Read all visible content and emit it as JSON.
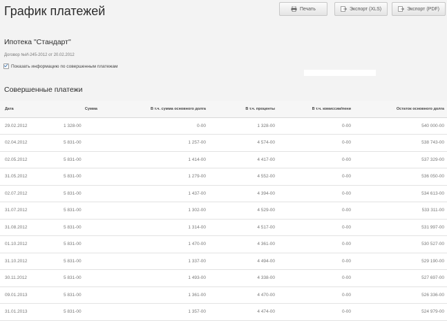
{
  "page": {
    "title": "График платежей",
    "subtitle": "Ипотека \"Стандарт\"",
    "contract": "Договор №И-245-2012 от 20.02.2012",
    "show_paid_label": "Показать информацию по совершенным платежам",
    "show_paid_checked": true,
    "section_title": "Совершенные платежи"
  },
  "toolbar": {
    "print_label": "Печать",
    "export_xls_label": "Экспорт (XLS)",
    "export_pdf_label": "Экспорт (PDF)"
  },
  "table": {
    "headers": [
      "Дата",
      "Сумма",
      "В т.ч. сумма основного долга",
      "В т.ч. проценты",
      "В т.ч. комиссии/пени",
      "Остаток основного долга"
    ],
    "rows": [
      [
        "29.02.2012",
        "1 328-00",
        "0-00",
        "1 328-00",
        "0-00",
        "540 000-00"
      ],
      [
        "02.04.2012",
        "5 831-00",
        "1 257-00",
        "4 574-00",
        "0-00",
        "538 743-00"
      ],
      [
        "02.05.2012",
        "5 831-00",
        "1 414-00",
        "4 417-00",
        "0-00",
        "537 329-00"
      ],
      [
        "31.05.2012",
        "5 831-00",
        "1 279-00",
        "4 552-00",
        "0-00",
        "536 050-00"
      ],
      [
        "02.07.2012",
        "5 831-00",
        "1 437-00",
        "4 394-00",
        "0-00",
        "534 613-00"
      ],
      [
        "31.07.2012",
        "5 831-00",
        "1 302-00",
        "4 529-00",
        "0-00",
        "533 311-00"
      ],
      [
        "31.08.2012",
        "5 831-00",
        "1 314-00",
        "4 517-00",
        "0-00",
        "531 997-00"
      ],
      [
        "01.10.2012",
        "5 831-00",
        "1 470-00",
        "4 361-00",
        "0-00",
        "530 527-00"
      ],
      [
        "31.10.2012",
        "5 831-00",
        "1 337-00",
        "4 494-00",
        "0-00",
        "529 190-00"
      ],
      [
        "30.11.2012",
        "5 831-00",
        "1 493-00",
        "4 338-00",
        "0-00",
        "527 697-00"
      ],
      [
        "09.01.2013",
        "5 831-00",
        "1 361-00",
        "4 470-00",
        "0-00",
        "526 336-00"
      ],
      [
        "31.01.2013",
        "5 831-00",
        "1 357-00",
        "4 474-00",
        "0-00",
        "524 979-00"
      ]
    ]
  }
}
